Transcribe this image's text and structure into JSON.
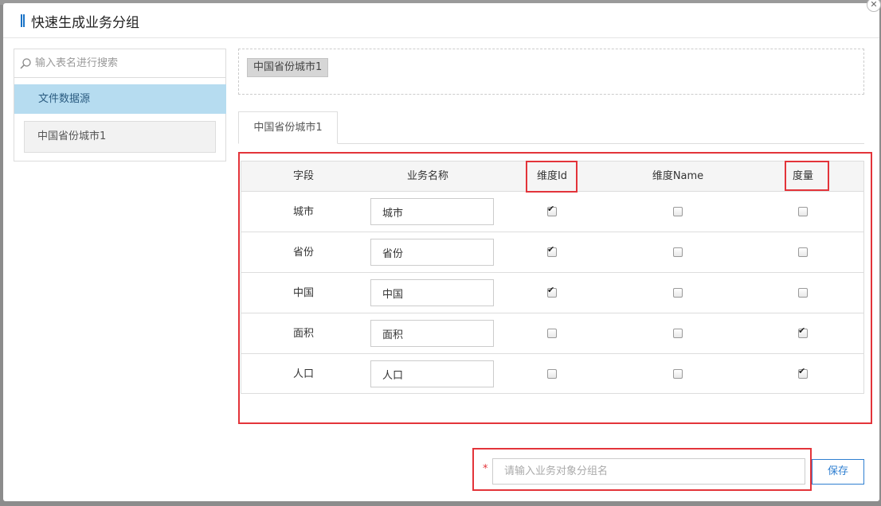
{
  "modal": {
    "title": "快速生成业务分组",
    "close_glyph": "✕"
  },
  "sidebar": {
    "search_placeholder": "输入表名进行搜索",
    "source_header": "文件数据源",
    "items": [
      {
        "label": "中国省份城市1"
      }
    ]
  },
  "selected_tags": [
    {
      "label": "中国省份城市1"
    }
  ],
  "tabs": [
    {
      "label": "中国省份城市1",
      "active": true
    }
  ],
  "table": {
    "headers": [
      "字段",
      "业务名称",
      "维度Id",
      "维度Name",
      "度量"
    ],
    "rows": [
      {
        "field": "城市",
        "name": "城市",
        "dim_id": true,
        "dim_name": false,
        "measure": false
      },
      {
        "field": "省份",
        "name": "省份",
        "dim_id": true,
        "dim_name": false,
        "measure": false
      },
      {
        "field": "中国",
        "name": "中国",
        "dim_id": true,
        "dim_name": false,
        "measure": false
      },
      {
        "field": "面积",
        "name": "面积",
        "dim_id": false,
        "dim_name": false,
        "measure": true
      },
      {
        "field": "人口",
        "name": "人口",
        "dim_id": false,
        "dim_name": false,
        "measure": true
      }
    ]
  },
  "footer": {
    "required_mark": "*",
    "group_placeholder": "请输入业务对象分组名",
    "save_label": "保存"
  },
  "colors": {
    "accent": "#2f7fd1",
    "highlight": "#e3343a",
    "source_header_bg": "#b6dcf0"
  }
}
